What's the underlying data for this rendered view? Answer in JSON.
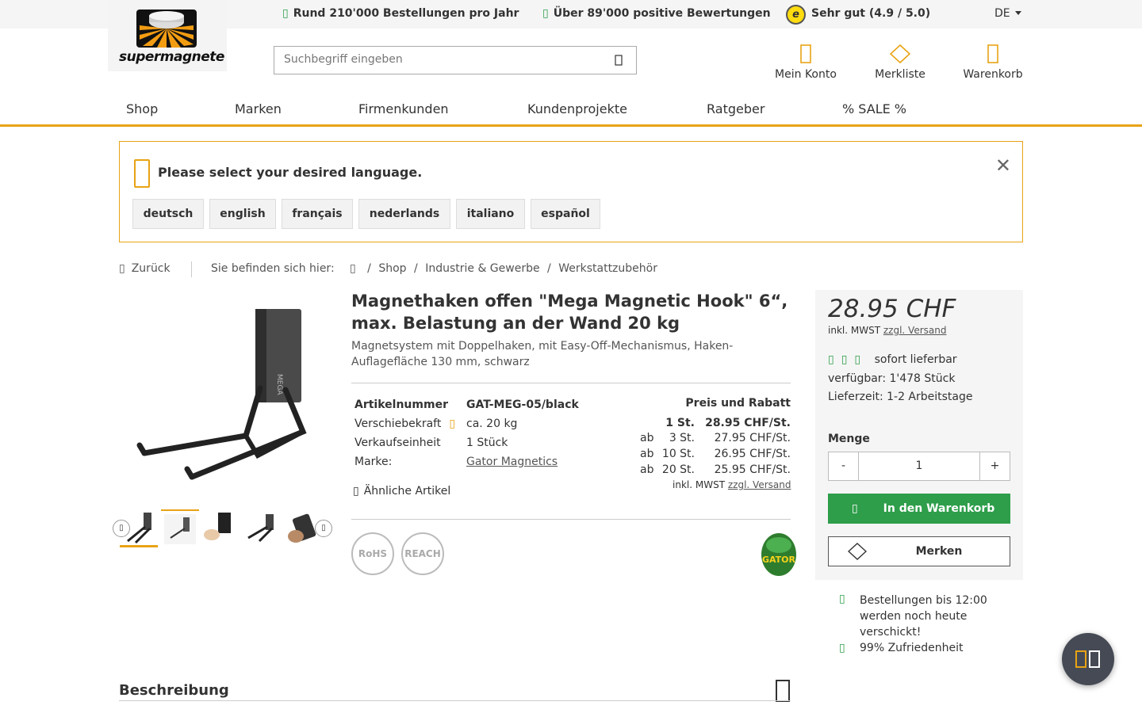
{
  "topbar": {
    "usp1": "Rund 210'000 Bestellungen pro Jahr",
    "usp2": "Über 89'000 positive Bewertungen",
    "rating": "Sehr gut (4.9 / 5.0)",
    "trusted_mark": "e",
    "language": "DE"
  },
  "brand": {
    "name": "supermagnete"
  },
  "search": {
    "placeholder": "Suchbegriff eingeben"
  },
  "header_icons": {
    "account": "Mein Konto",
    "wishlist": "Merkliste",
    "cart": "Warenkorb"
  },
  "nav": [
    "Shop",
    "Marken",
    "Firmenkunden",
    "Kundenprojekte",
    "Ratgeber",
    "% SALE %"
  ],
  "language_prompt": {
    "message": "Please select your desired language.",
    "options": [
      "deutsch",
      "english",
      "français",
      "nederlands",
      "italiano",
      "español"
    ]
  },
  "breadcrumb": {
    "back": "Zurück",
    "intro": "Sie befinden sich hier:",
    "items": [
      "Shop",
      "Industrie & Gewerbe",
      "Werkstattzubehör"
    ],
    "sep": "/"
  },
  "product": {
    "title": "Magnethaken offen \"Mega Magnetic Hook\" 6“, max. Belastung an der Wand 20 kg",
    "subtitle": "Magnetsystem mit Doppelhaken, mit Easy-Off-Mechanismus, Haken-Auflagefläche 130 mm, schwarz",
    "specs": {
      "sku_label": "Artikelnummer",
      "sku_value": "GAT-MEG-05/black",
      "force_label": "Verschiebekraft",
      "force_value": "ca. 20 kg",
      "unit_label": "Verkaufseinheit",
      "unit_value": "1 Stück",
      "brand_label": "Marke:",
      "brand_value": "Gator Magnetics"
    },
    "similar": "Ähnliche Artikel",
    "badges": [
      "RoHS",
      "REACH"
    ],
    "brand_logo": "GATOR"
  },
  "pricing": {
    "header": "Preis und Rabatt",
    "tiers": [
      {
        "prefix": "",
        "qty": "1 St.",
        "price": "28.95 CHF/St."
      },
      {
        "prefix": "ab",
        "qty": "3 St.",
        "price": "27.95 CHF/St."
      },
      {
        "prefix": "ab",
        "qty": "10 St.",
        "price": "26.95 CHF/St."
      },
      {
        "prefix": "ab",
        "qty": "20 St.",
        "price": "25.95 CHF/St."
      }
    ],
    "vat_note": "inkl. MWST",
    "shipping_link": "zzgl. Versand"
  },
  "buybox": {
    "price": "28.95 CHF",
    "vat_note": "inkl. MWST",
    "shipping_link": "zzgl. Versand",
    "availability": "sofort lieferbar",
    "stock": "verfügbar: 1'478 Stück",
    "delivery": "Lieferzeit: 1-2 Arbeitstage",
    "qty_label": "Menge",
    "qty_minus": "-",
    "qty_value": "1",
    "qty_plus": "+",
    "add_to_cart": "In den Warenkorb",
    "wishlist": "Merken"
  },
  "benefits": [
    "Bestellungen bis 12:00 werden noch heute verschickt!",
    "99% Zufriedenheit"
  ],
  "image_mark": "MEGA",
  "section_title": "Beschreibung",
  "colors": {
    "accent": "#e8a315",
    "green": "#2e9e4a",
    "text": "#333333"
  }
}
